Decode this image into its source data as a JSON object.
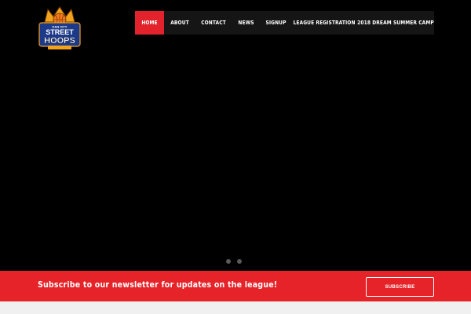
{
  "logo": {
    "line1": "KAN CITY",
    "line2": "STREET",
    "line3": "HOOPS",
    "icon": "crown-basketball-logo"
  },
  "nav": {
    "items": [
      {
        "label": "HOME",
        "active": true
      },
      {
        "label": "ABOUT",
        "active": false
      },
      {
        "label": "CONTACT",
        "active": false
      },
      {
        "label": "NEWS",
        "active": false
      },
      {
        "label": "SIGNUP",
        "active": false
      },
      {
        "label": "LEAGUE REGISTRATION",
        "active": false
      },
      {
        "label": "2018 DREAM SUMMER CAMP",
        "active": false
      }
    ]
  },
  "slider": {
    "dot_count": 2
  },
  "newsletter": {
    "text": "Subscribe to our newsletter for updates on the league!",
    "button_label": "SUBSCRIBE"
  },
  "colors": {
    "accent": "#e52328",
    "nav_bg": "#151515",
    "hero_bg": "#000000",
    "footer_bg": "#f0f0f0"
  }
}
